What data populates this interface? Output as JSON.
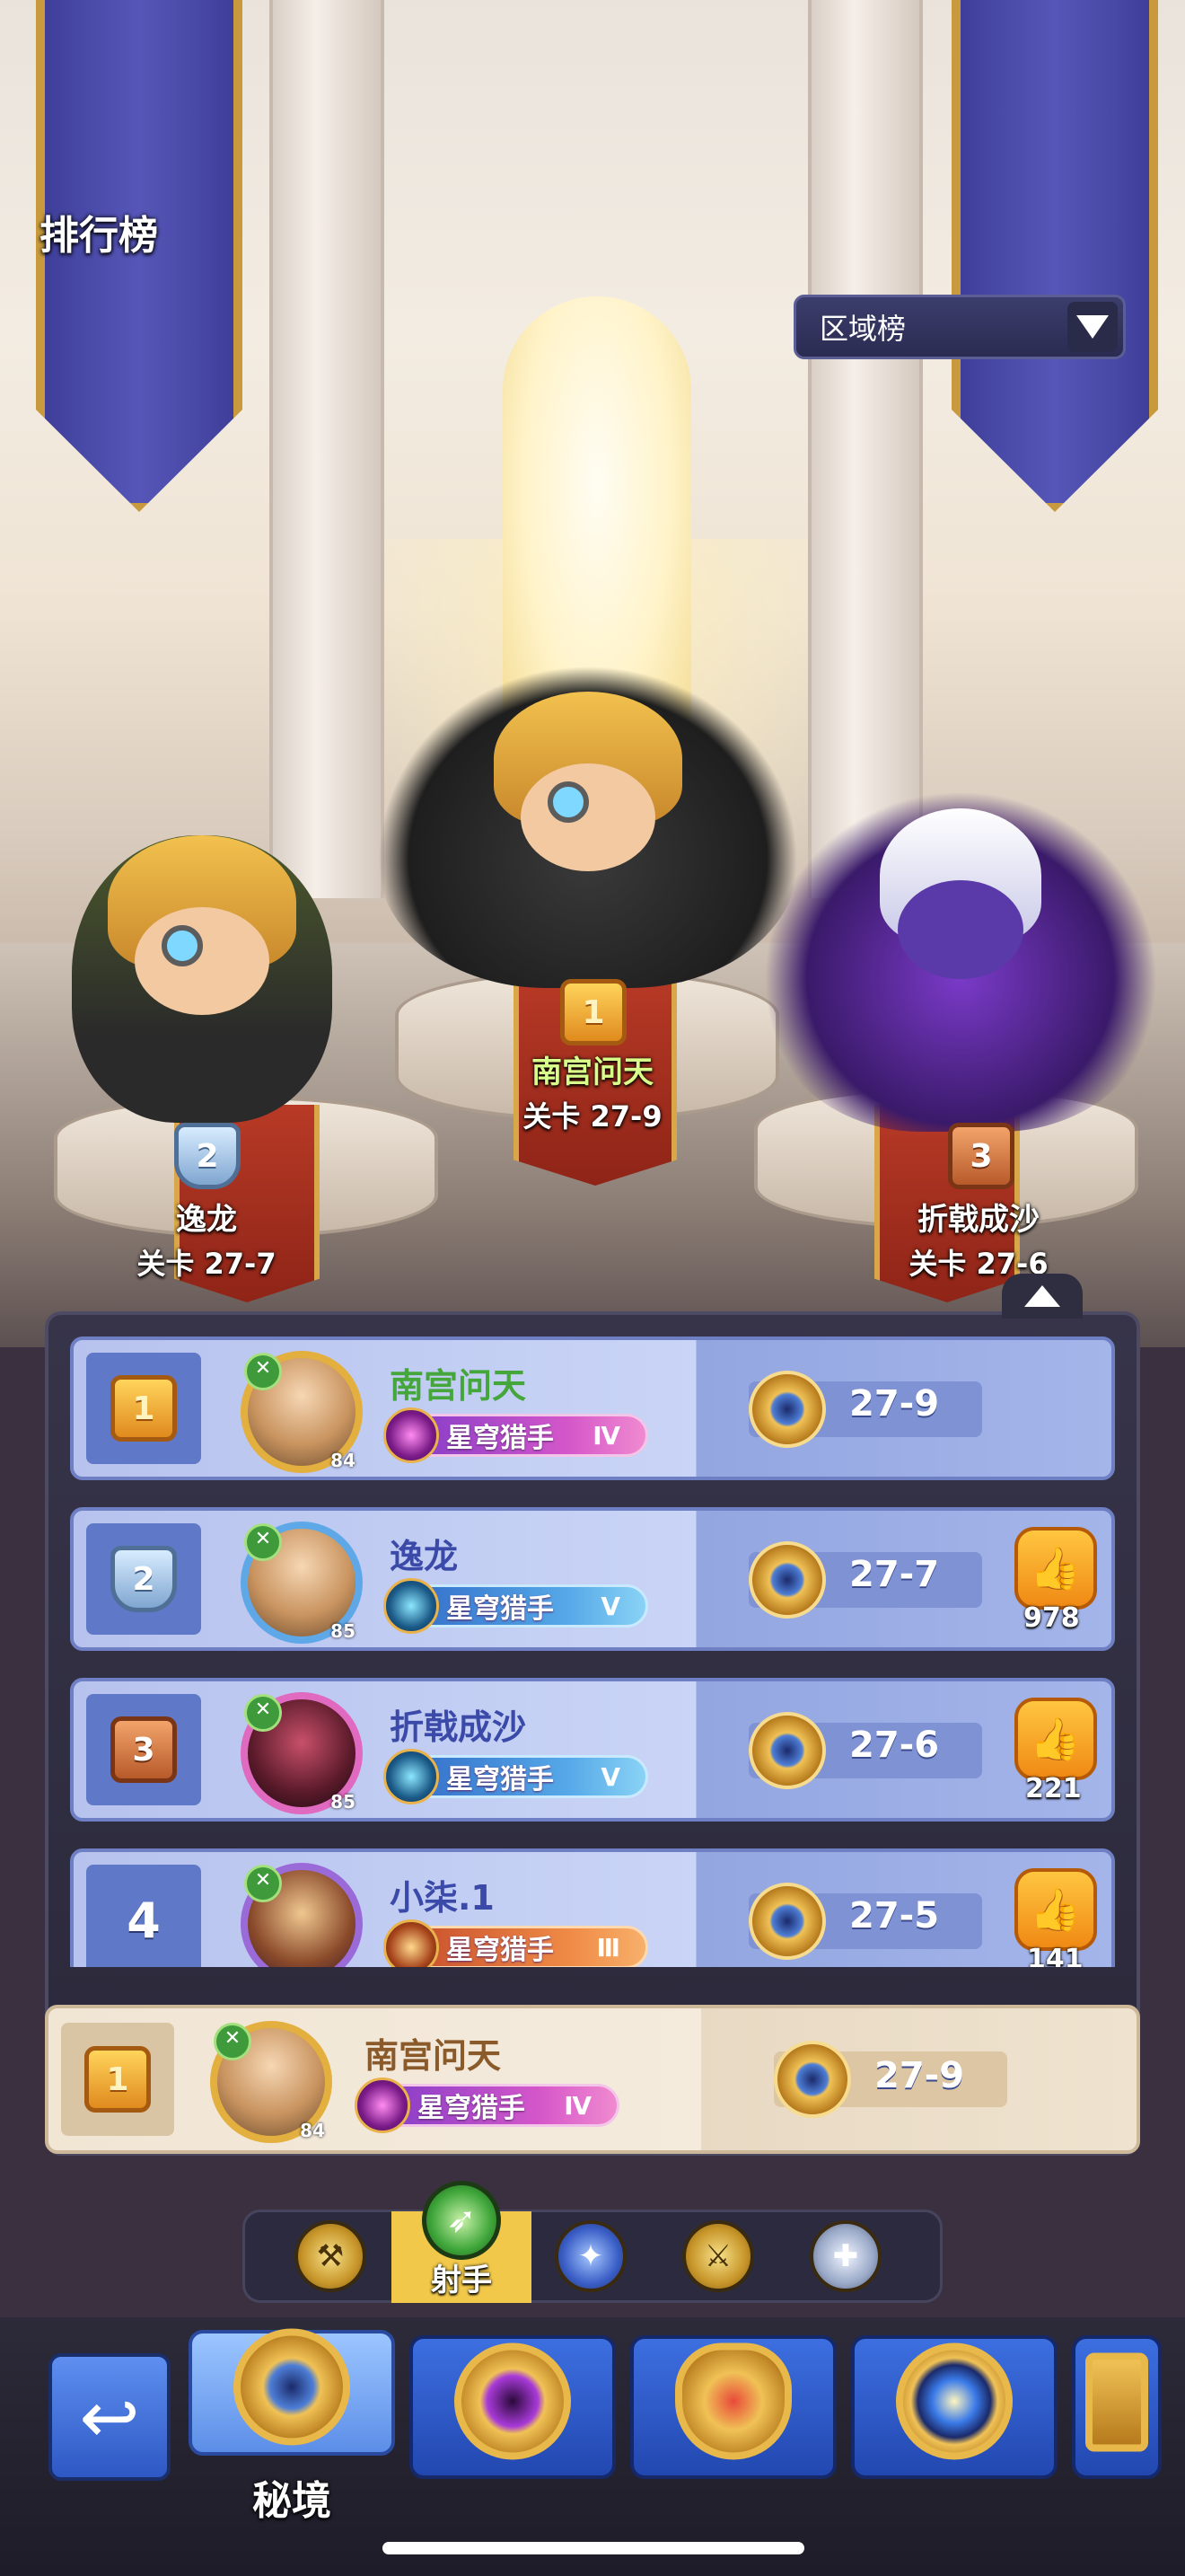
{
  "header": {
    "title": "排行榜",
    "region_select": {
      "value": "区域榜"
    }
  },
  "podium": [
    {
      "rank": "1",
      "name": "南宫问天",
      "stage": "关卡 27-9"
    },
    {
      "rank": "2",
      "name": "逸龙",
      "stage": "关卡 27-7"
    },
    {
      "rank": "3",
      "name": "折戟成沙",
      "stage": "关卡 27-6"
    }
  ],
  "ranking": {
    "rows": [
      {
        "rank": "1",
        "name": "南宫问天",
        "level": "84",
        "title": "星穹猎手",
        "tier": "Ⅳ",
        "stage": "27-9",
        "likes": ""
      },
      {
        "rank": "2",
        "name": "逸龙",
        "level": "85",
        "title": "星穹猎手",
        "tier": "Ⅴ",
        "stage": "27-7",
        "likes": "978"
      },
      {
        "rank": "3",
        "name": "折戟成沙",
        "level": "85",
        "title": "星穹猎手",
        "tier": "Ⅴ",
        "stage": "27-6",
        "likes": "221"
      },
      {
        "rank": "4",
        "name": "小柒.1",
        "level": "",
        "title": "星穹猎手",
        "tier": "Ⅲ",
        "stage": "27-5",
        "likes": "141"
      }
    ],
    "self": {
      "rank": "1",
      "name": "南宫问天",
      "level": "84",
      "title": "星穹猎手",
      "tier": "Ⅳ",
      "stage": "27-9"
    }
  },
  "class_tabs": {
    "active_label": "射手",
    "icons": [
      "warrior-icon",
      "archer-icon",
      "mage-icon",
      "assassin-icon",
      "support-icon"
    ]
  },
  "modes": {
    "active_label": "秘境"
  },
  "colors": {
    "gold": "#f1c84a",
    "row_blue": "#b7c3ee",
    "self_row": "#f1e5d4"
  }
}
